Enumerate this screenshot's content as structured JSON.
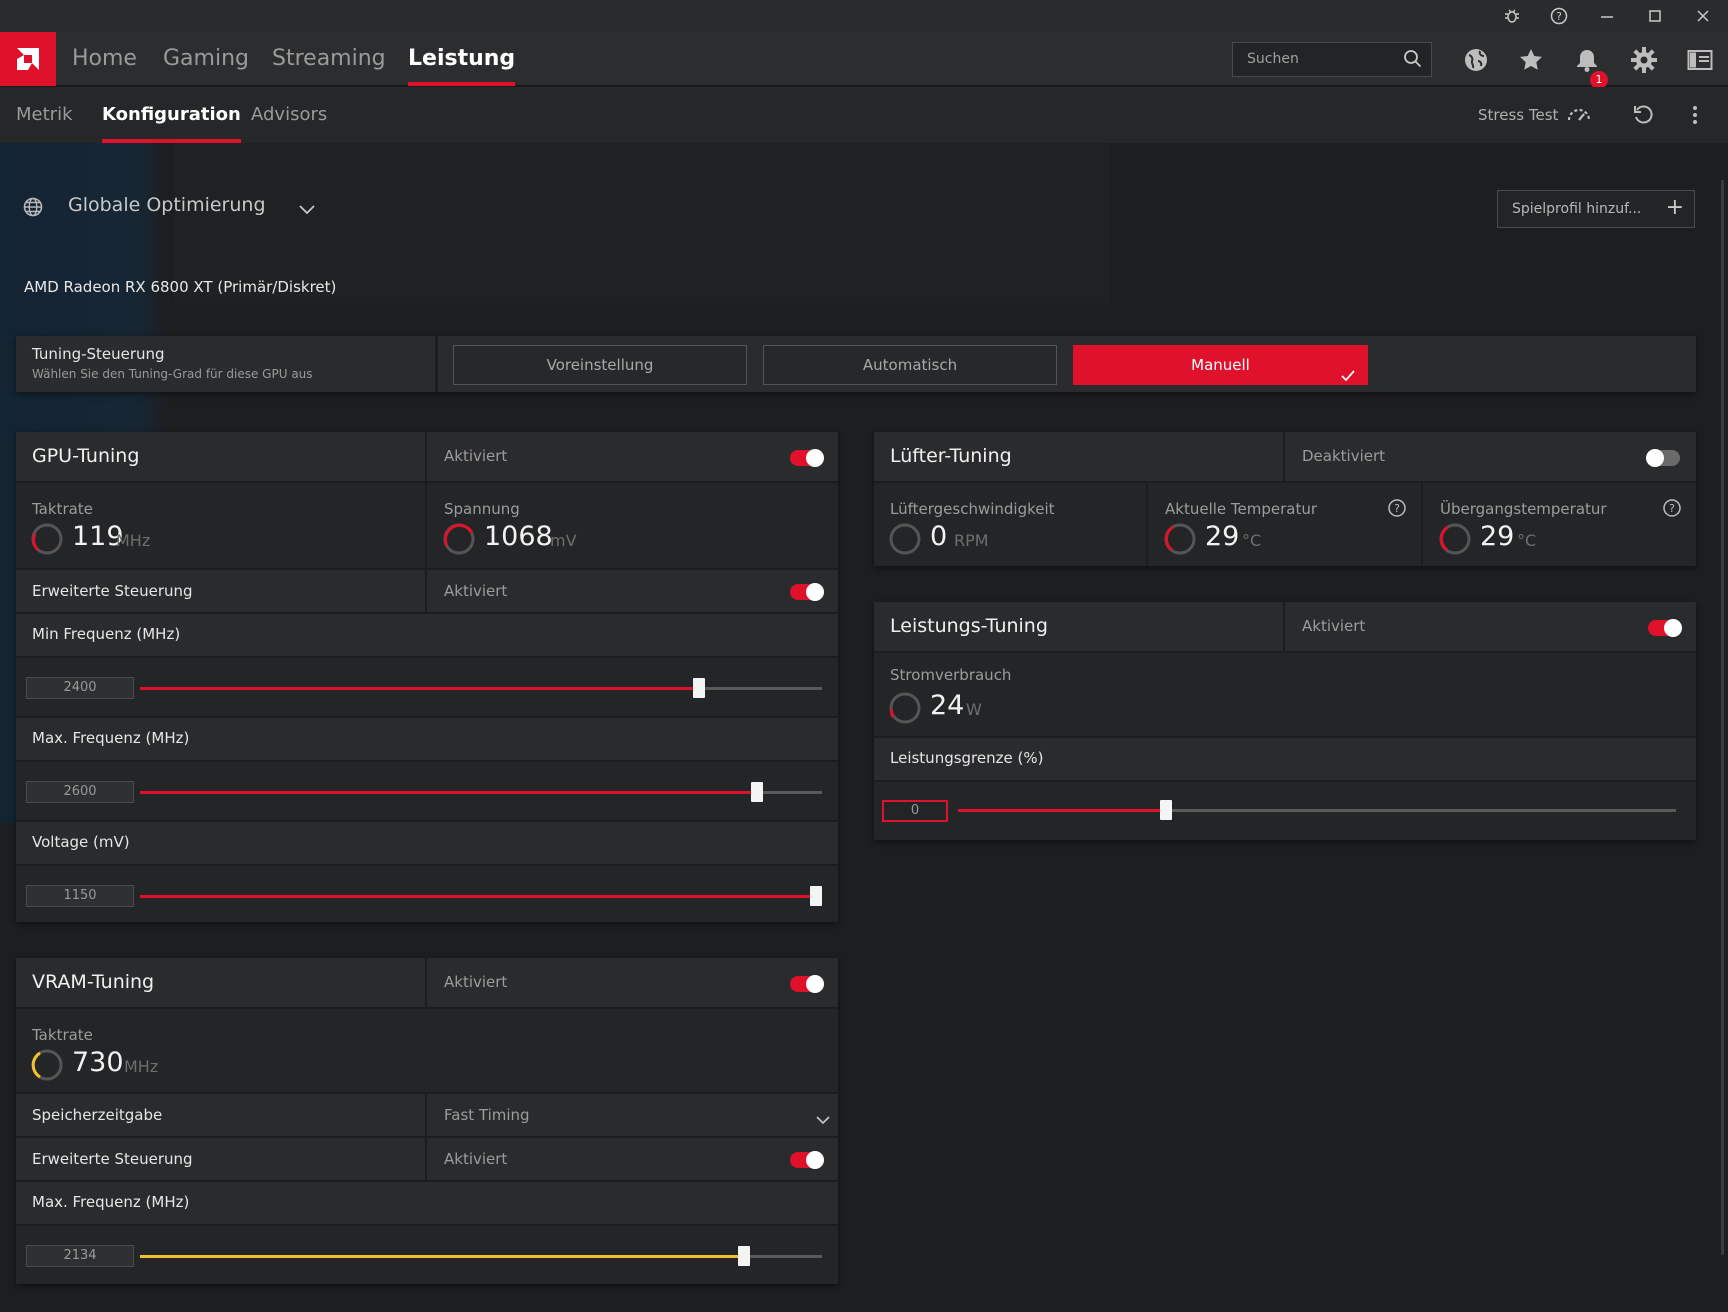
{
  "nav": {
    "tabs": [
      "Home",
      "Gaming",
      "Streaming",
      "Leistung"
    ],
    "search_placeholder": "Suchen",
    "notification_count": "1"
  },
  "subnav": {
    "tabs": [
      "Metrik",
      "Konfiguration",
      "Advisors"
    ],
    "stress_test": "Stress Test"
  },
  "profile": {
    "name": "Globale Optimierung",
    "add_profile": "Spielprofil hinzuf...",
    "gpu": "AMD Radeon RX 6800 XT (Primär/Diskret)"
  },
  "tuning_control": {
    "title": "Tuning-Steuerung",
    "subtitle": "Wählen Sie den Tuning-Grad für diese GPU aus",
    "options": [
      "Voreinstellung",
      "Automatisch",
      "Manuell"
    ],
    "selected": "Manuell"
  },
  "gpu_tuning": {
    "title": "GPU-Tuning",
    "status": "Aktiviert",
    "enabled": true,
    "clock": {
      "label": "Taktrate",
      "value": "119",
      "unit": "MHz"
    },
    "voltage": {
      "label": "Spannung",
      "value": "1068",
      "unit": "mV"
    },
    "advanced": {
      "label": "Erweiterte Steuerung",
      "status": "Aktiviert",
      "enabled": true
    },
    "min_freq": {
      "label": "Min Frequenz (MHz)",
      "value": "2400",
      "fraction": 0.82
    },
    "max_freq": {
      "label": "Max. Frequenz (MHz)",
      "value": "2600",
      "fraction": 0.905
    },
    "voltage_slider": {
      "label": "Voltage (mV)",
      "value": "1150",
      "fraction": 1.0
    }
  },
  "vram_tuning": {
    "title": "VRAM-Tuning",
    "status": "Aktiviert",
    "enabled": true,
    "clock": {
      "label": "Taktrate",
      "value": "730",
      "unit": "MHz"
    },
    "memory_timing": {
      "label": "Speicherzeitgabe",
      "value": "Fast Timing"
    },
    "advanced": {
      "label": "Erweiterte Steuerung",
      "status": "Aktiviert",
      "enabled": true
    },
    "max_freq": {
      "label": "Max. Frequenz (MHz)",
      "value": "2134",
      "fraction": 0.885
    }
  },
  "fan_tuning": {
    "title": "Lüfter-Tuning",
    "status": "Deaktiviert",
    "enabled": false,
    "fan_speed": {
      "label": "Lüftergeschwindigkeit",
      "value": "0",
      "unit": "RPM"
    },
    "current_temp": {
      "label": "Aktuelle Temperatur",
      "value": "29",
      "unit": "°C"
    },
    "junction_temp": {
      "label": "Übergangstemperatur",
      "value": "29",
      "unit": "°C"
    }
  },
  "power_tuning": {
    "title": "Leistungs-Tuning",
    "status": "Aktiviert",
    "enabled": true,
    "power_draw": {
      "label": "Stromverbrauch",
      "value": "24",
      "unit": "W"
    },
    "power_limit": {
      "label": "Leistungsgrenze (%)",
      "value": "0",
      "fraction": 0.29
    }
  },
  "colors": {
    "accent": "#e0112b",
    "vram_accent": "#f2c12e"
  }
}
